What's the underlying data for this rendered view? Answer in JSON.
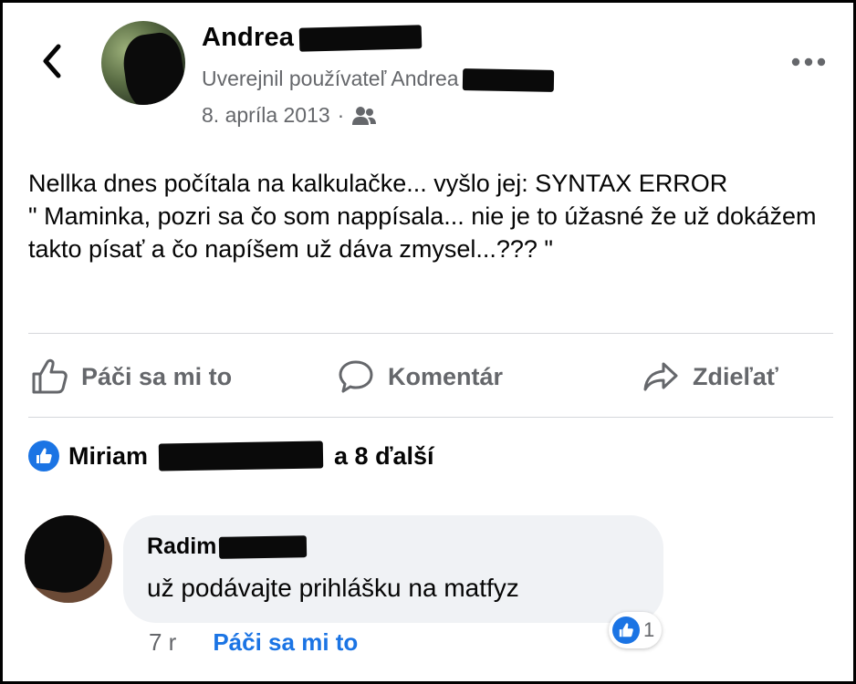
{
  "header": {
    "author_first_name": "Andrea",
    "posted_by_label": "Uverejnil používateľ Andrea",
    "date": "8. apríla 2013",
    "separator": "·",
    "audience_icon": "friends-icon",
    "back_icon": "chevron-left-icon",
    "more_icon": "more-horizontal-icon"
  },
  "post": {
    "lines": [
      "Nellka dnes počítala na kalkulačke... vyšlo jej: SYNTAX ERROR",
      "\" Maminka, pozri sa čo som nappísala... nie je to úžasné že už dokážem takto písať a čo napíšem už dáva zmysel...??? \""
    ]
  },
  "actions": {
    "like": "Páči sa mi to",
    "comment": "Komentár",
    "share": "Zdieľať"
  },
  "reactions": {
    "first_name": "Miriam",
    "rest": "a 8 ďalší"
  },
  "comment": {
    "author_first_name": "Radim",
    "text": "už podávajte prihlášku na matfyz",
    "time": "7 r",
    "like_label": "Páči sa mi to",
    "reaction_count": "1"
  },
  "colors": {
    "accent": "#1b74e4",
    "secondary_text": "#65676b",
    "bubble": "#f0f2f5"
  }
}
